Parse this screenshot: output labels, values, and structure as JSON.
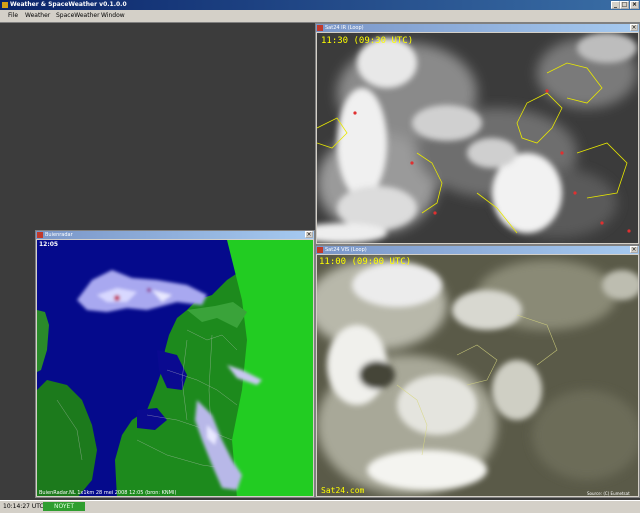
{
  "app": {
    "title": "Weather & SpaceWeather v0.1.0.0",
    "minimize_glyph": "_",
    "maximize_glyph": "□",
    "close_glyph": "×"
  },
  "menu": {
    "items": [
      "File",
      "Weather",
      "SpaceWeather",
      "Window"
    ]
  },
  "windows": {
    "sat_ir": {
      "title": "Sat24 IR (Loop)",
      "time_label": "11:30 (09:30 UTC)",
      "close_glyph": "×"
    },
    "sat_vis": {
      "title": "Sat24 VIS (Loop)",
      "time_label": "11:00 (09:00 UTC)",
      "watermark": "Sat24.com",
      "corner_label": "Source: (C) Eumetsat",
      "close_glyph": "×"
    },
    "buienradar": {
      "title": "Buienradar",
      "time_label": "12:05",
      "footer": "BuienRadar.NL   1x1km  28 mei 2008 12:05 (bron: KNMI)",
      "close_glyph": "×"
    }
  },
  "status": {
    "time": "10:14:27 UTC",
    "badge": "NOYET",
    "badge_color": "#2f9e2f"
  }
}
